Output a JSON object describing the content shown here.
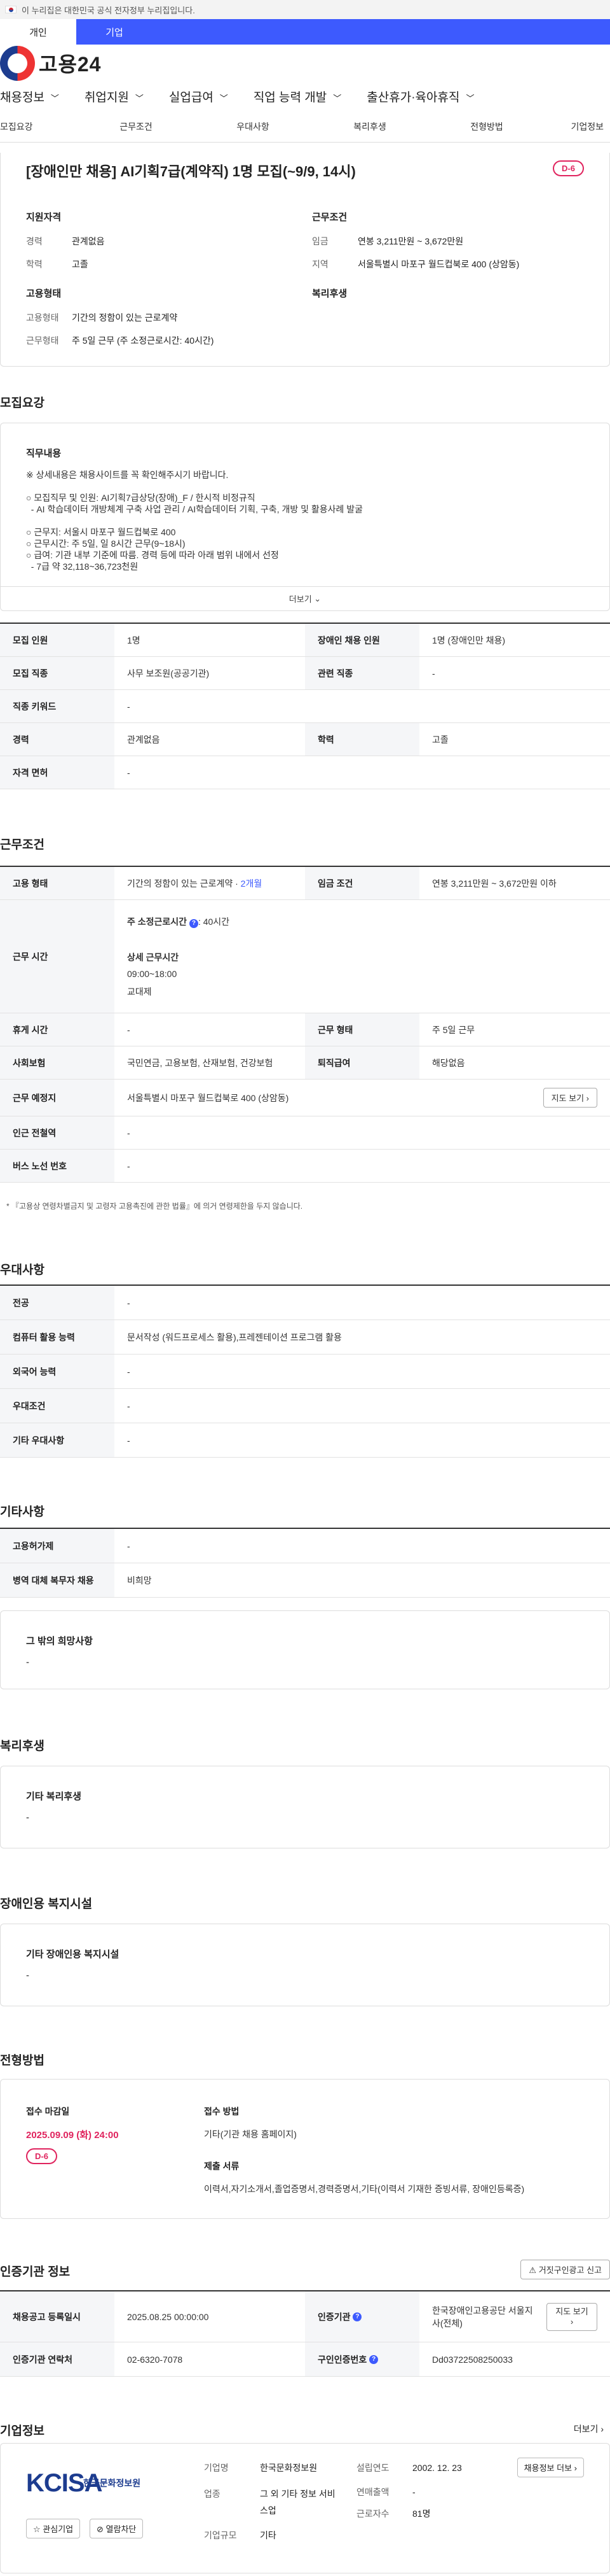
{
  "gov_banner": {
    "text": "이 누리집은 대한민국 공식 전자정부 누리집입니다."
  },
  "top_tabs": [
    "개인",
    "기업"
  ],
  "brand": {
    "name": "고용24"
  },
  "gnb": [
    "채용정보",
    "취업지원",
    "실업급여",
    "직업 능력 개발",
    "출산휴가·육아휴직"
  ],
  "subnav": [
    "모집요강",
    "근무조건",
    "우대사항",
    "복리후생",
    "전형방법",
    "기업정보"
  ],
  "job": {
    "title": "[장애인만 채용] AI기획7급(계약직) 1명 모집(~9/9, 14시)",
    "dday": "D-6",
    "qual_title": "지원자격",
    "qual": [
      {
        "k": "경력",
        "v": "관계없음"
      },
      {
        "k": "학력",
        "v": "고졸"
      }
    ],
    "cond_title": "근무조건",
    "cond": [
      {
        "k": "임금",
        "v": "연봉 3,211만원 ~ 3,672만원"
      },
      {
        "k": "지역",
        "v": "서울특별시 마포구 월드컵북로 400 (상암동)"
      }
    ],
    "emp_title": "고용형태",
    "emp": [
      {
        "k": "고용형태",
        "v": "기간의 정함이 있는 근로계약"
      },
      {
        "k": "근무형태",
        "v": "주 5일 근무 (주 소정근로시간: 40시간)"
      }
    ],
    "welfare_title": "복리후생"
  },
  "recruit": {
    "title": "모집요강",
    "duty_title": "직무내용",
    "duty_lines": [
      "※ 상세내용은 채용사이트를 꼭 확인해주시기 바랍니다.",
      "",
      "○ 모집직무 및 인원: AI기획7급상당(장애)_F / 한시적 비정규직",
      "  - AI 학습데이터 개방체계 구축 사업 관리 / AI학습데이터 기획, 구축, 개방 및 활용사례 발굴",
      "",
      "○ 근무지: 서울시 마포구 월드컵북로 400",
      "○ 근무시간: 주 5일, 일 8시간 근무(9~18시)",
      "○ 급여: 기관 내부 기준에 따름. 경력 등에 따라 아래 범위 내에서 선정",
      "  - 7급 약 32,118~36,723천원"
    ],
    "more": "더보기",
    "rows": [
      [
        [
          "모집 인원",
          "1명"
        ],
        [
          "장애인 채용 인원",
          "1명 (장애인만 채용)"
        ]
      ],
      [
        [
          "모집 직종",
          "사무 보조원(공공기관)"
        ],
        [
          "관련 직종",
          "-"
        ]
      ],
      [
        [
          "직종 키워드",
          "-"
        ]
      ],
      [
        [
          "경력",
          "관계없음"
        ],
        [
          "학력",
          "고졸"
        ]
      ],
      [
        [
          "자격 면허",
          "-"
        ]
      ]
    ]
  },
  "work": {
    "title": "근무조건",
    "emp_type_label": "고용 형태",
    "emp_type": "기간의 정함이 있는 근로계약 ·",
    "emp_period": "2개월",
    "wage_label": "임금 조건",
    "wage": "연봉 3,211만원 ~ 3,672만원 이하",
    "hours_label": "근무 시간",
    "hours_a": "주 소정근로시간",
    "hours_b": ": 40시간",
    "hours_c": "상세 근무시간",
    "hours_d": "09:00~18:00",
    "hours_e": "교대제",
    "rows": [
      [
        [
          "휴게 시간",
          "-"
        ],
        [
          "근무 형태",
          "주 5일 근무"
        ]
      ],
      [
        [
          "사회보험",
          "국민연금, 고용보험, 산재보험, 건강보험"
        ],
        [
          "퇴직급여",
          "해당없음"
        ]
      ]
    ],
    "place_label": "근무 예정지",
    "place": "서울특별시 마포구 월드컵북로 400 (상암동)",
    "map_btn": "지도 보기",
    "rows2": [
      [
        "인근 전철역",
        "-"
      ],
      [
        "버스 노선 번호",
        "-"
      ]
    ],
    "note": "* 『고용상 연령차별금지 및 고령자 고용촉진에 관한 법률』에 의거 연령제한을 두지 않습니다."
  },
  "pref": {
    "title": "우대사항",
    "rows": [
      [
        "전공",
        "-"
      ],
      [
        "컴퓨터 활용 능력",
        "문서작성 (워드프로세스 활용),프레젠테이션 프로그램 활용"
      ],
      [
        "외국어 능력",
        "-"
      ],
      [
        "우대조건",
        "-"
      ],
      [
        "기타 우대사항",
        "-"
      ]
    ]
  },
  "etc": {
    "title": "기타사항",
    "rows": [
      [
        "고용허가제",
        "-"
      ],
      [
        "병역 대체 복무자 채용",
        "비희망"
      ]
    ],
    "other_title": "그 밖의 희망사항",
    "other_val": "-"
  },
  "welfare": {
    "title": "복리후생",
    "label": "기타 복리후생",
    "val": "-"
  },
  "facility": {
    "title": "장애인용 복지시설",
    "label": "기타 장애인용 복지시설",
    "val": "-"
  },
  "apply": {
    "title": "전형방법",
    "deadline_label": "접수 마감일",
    "deadline": "2025.09.09 (화) 24:00",
    "dday": "D-6",
    "method_label": "접수 방법",
    "method": "기타(기관 채용 홈페이지)",
    "docs_label": "제출 서류",
    "docs": "이력서,자기소개서,졸업증명서,경력증명서,기타(이력서 기재한 증빙서류, 장애인등록증)"
  },
  "cert": {
    "title": "인증기관 정보",
    "report_btn": "거짓구인광고 신고",
    "reg_label": "채용공고 등록일시",
    "reg": "2025.08.25 00:00:00",
    "org_label": "인증기관",
    "org": "한국장애인고용공단 서울지사(전체)",
    "map_btn": "지도 보기",
    "contact_label": "인증기관 연락처",
    "contact": "02-6320-7078",
    "cert_no_label": "구인인증번호",
    "cert_no": "Dd03722508250033"
  },
  "company": {
    "title": "기업정보",
    "more": "더보기",
    "logo_text": "KCISA",
    "logo_sub": "한국문화정보원",
    "fav_btn": "관심기업",
    "block_btn": "열람차단",
    "name_label": "기업명",
    "name": "한국문화정보원",
    "industry_label": "업종",
    "industry": "그 외 기타 정보 서비스업",
    "size_label": "기업규모",
    "size": "기타",
    "founded_label": "설립연도",
    "founded": "2002. 12. 23",
    "sales_label": "연매출액",
    "sales": "-",
    "staff_label": "근로자수",
    "staff": "81명",
    "jobs_btn": "채용정보 더보"
  },
  "colors": {
    "brand_blue": "#3d5afe",
    "dday_red": "#e0245e"
  }
}
